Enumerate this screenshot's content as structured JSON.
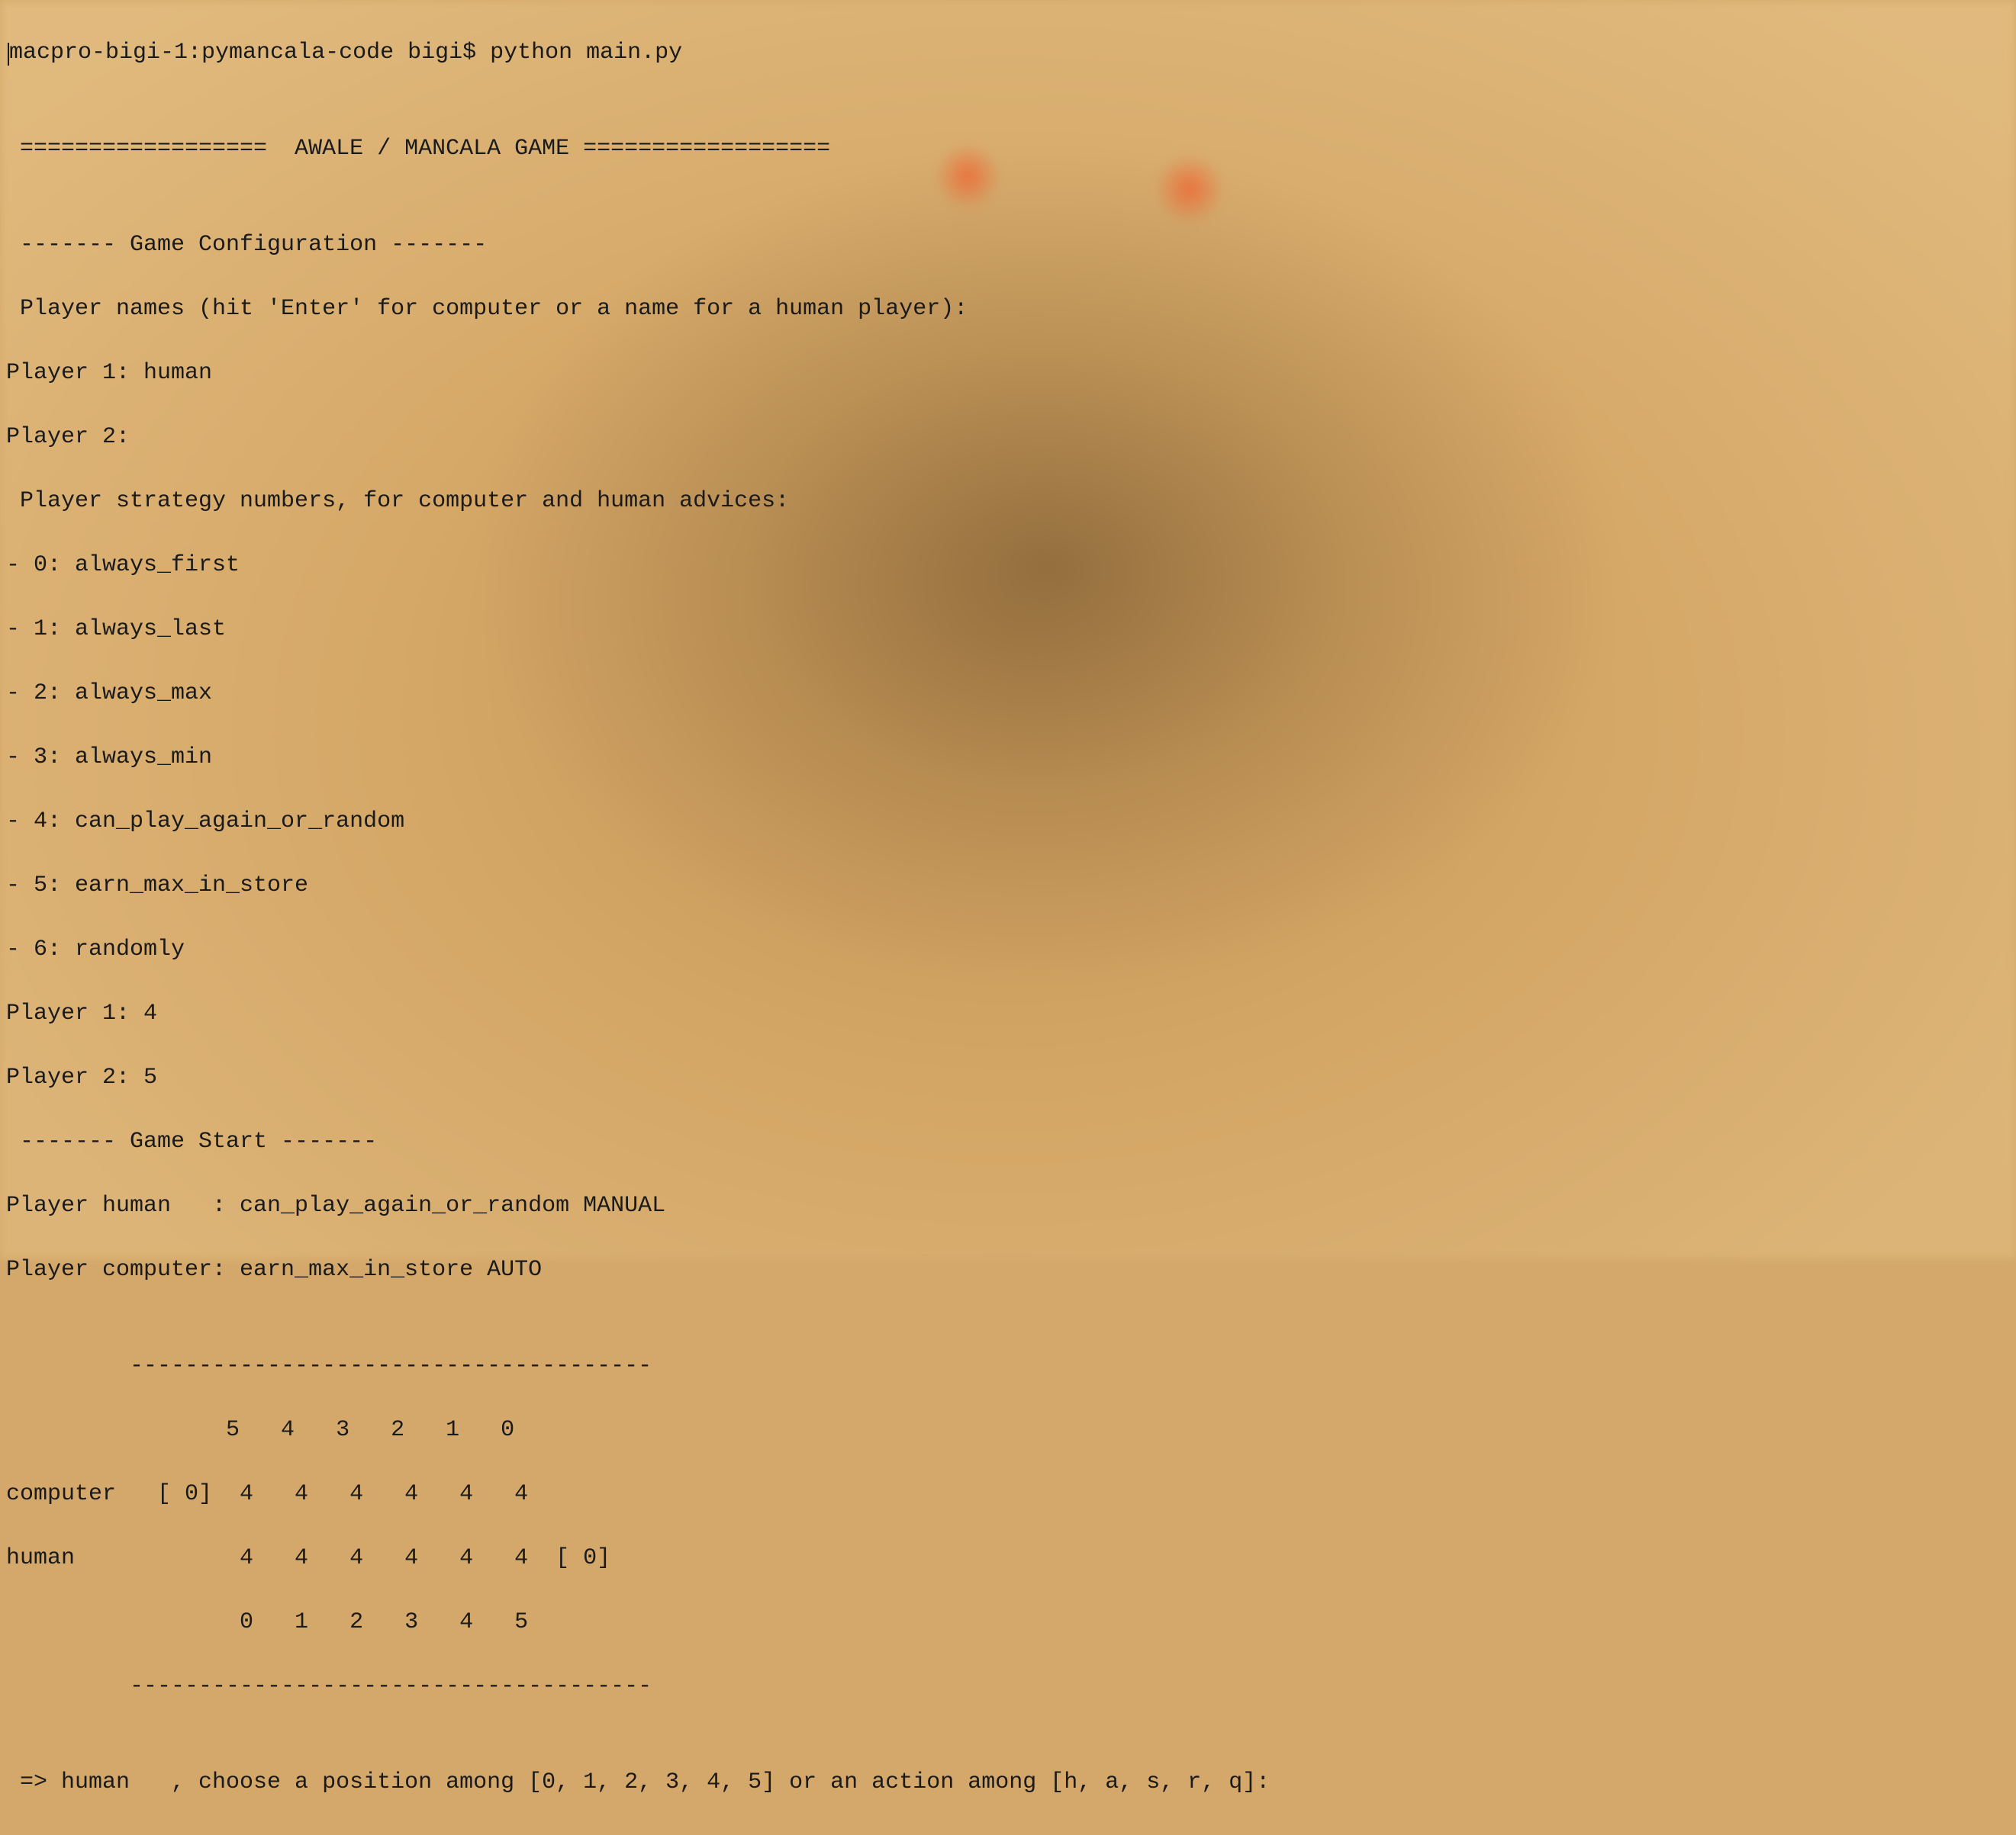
{
  "terminal": {
    "prompt": "macpro-bigi-1:pymancala-code bigi$ ",
    "command": "python main.py",
    "blank": "",
    "title_line": " ==================  AWALE / MANCALA GAME ==================",
    "config_header": " ------- Game Configuration -------",
    "config_prompt": " Player names (hit 'Enter' for computer or a name for a human player):",
    "p1_name_line": "Player 1: human",
    "p2_name_line": "Player 2: ",
    "strategy_prompt": " Player strategy numbers, for computer and human advices:",
    "strategies": [
      "- 0: always_first",
      "- 1: always_last",
      "- 2: always_max",
      "- 3: always_min",
      "- 4: can_play_again_or_random",
      "- 5: earn_max_in_store",
      "- 6: randomly"
    ],
    "p1_strategy_line": "Player 1: 4",
    "p2_strategy_line": "Player 2: 5",
    "start_header": " ------- Game Start -------",
    "p1_summary": "Player human   : can_play_again_or_random MANUAL",
    "p2_summary": "Player computer: earn_max_in_store AUTO",
    "board": {
      "divider": "         --------------------------------------",
      "top_idx": "                5   4   3   2   1   0",
      "computer_row": "computer   [ 0]  4   4   4   4   4   4",
      "human_row": "human            4   4   4   4   4   4  [ 0]",
      "bot_idx": "                 0   1   2   3   4   5"
    },
    "input_prompt": " => human   , choose a position among [0, 1, 2, 3, 4, 5] or an action among [h, a, s, r, q]: "
  },
  "game_state": {
    "players": {
      "player1": {
        "name": "human",
        "strategy_id": 4,
        "strategy_name": "can_play_again_or_random",
        "mode": "MANUAL",
        "store": 0,
        "pits": [
          4,
          4,
          4,
          4,
          4,
          4
        ]
      },
      "player2": {
        "name": "computer",
        "strategy_id": 5,
        "strategy_name": "earn_max_in_store",
        "mode": "AUTO",
        "store": 0,
        "pits": [
          4,
          4,
          4,
          4,
          4,
          4
        ]
      }
    },
    "valid_positions": [
      0,
      1,
      2,
      3,
      4,
      5
    ],
    "valid_actions": [
      "h",
      "a",
      "s",
      "r",
      "q"
    ],
    "current_turn": "human"
  }
}
